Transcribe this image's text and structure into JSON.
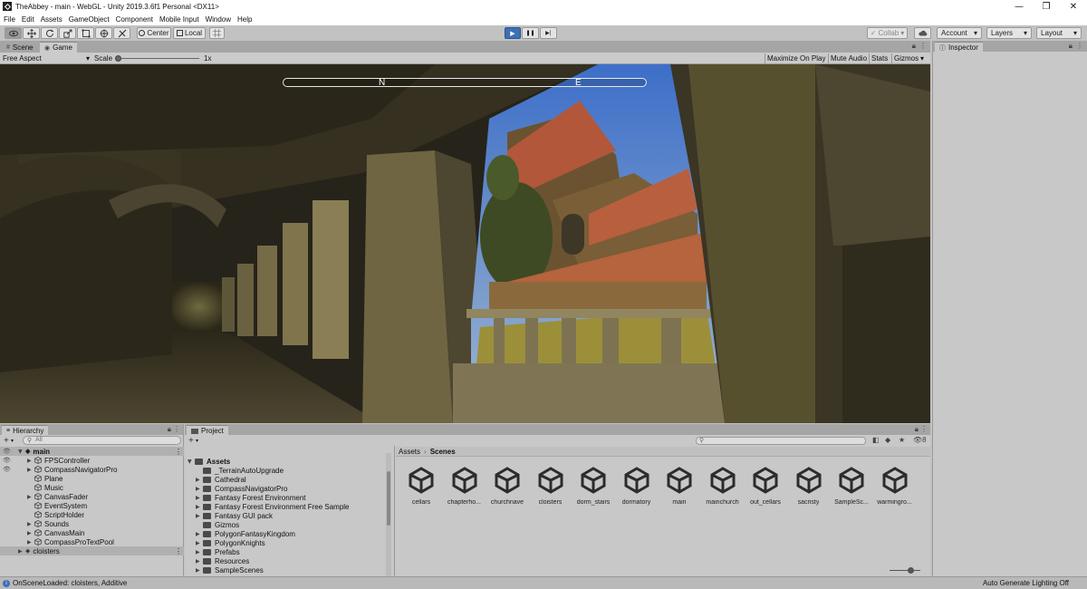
{
  "window": {
    "title": "TheAbbey - main - WebGL - Unity 2019.3.6f1 Personal <DX11>",
    "minimize_glyph": "—",
    "maximize_glyph": "❐",
    "close_glyph": "✕"
  },
  "menu": [
    "File",
    "Edit",
    "Assets",
    "GameObject",
    "Component",
    "Mobile Input",
    "Window",
    "Help"
  ],
  "toolbar": {
    "tools": [
      "view-tool-icon",
      "move-tool-icon",
      "rotate-tool-icon",
      "scale-tool-icon",
      "rect-tool-icon",
      "transform-tool-icon",
      "custom-tool-icon"
    ],
    "pivot_label": "Center",
    "space_label": "Local",
    "collab_label": "Collab",
    "account_label": "Account",
    "layers_label": "Layers",
    "layout_label": "Layout",
    "dropdown_glyph": "▾",
    "play_glyph": "▶",
    "pause_glyph": "❚❚",
    "step_glyph": "▶|"
  },
  "view_tabs": {
    "scene_label": "Scene",
    "game_label": "Game"
  },
  "game_bar": {
    "aspect_label": "Free Aspect",
    "scale_label": "Scale",
    "scale_value": "1x",
    "scale_fraction": 0.0,
    "maximize_label": "Maximize On Play",
    "mute_label": "Mute Audio",
    "stats_label": "Stats",
    "gizmos_label": "Gizmos"
  },
  "compass": {
    "north": "N",
    "east": "E"
  },
  "inspector": {
    "tab_label": "Inspector"
  },
  "hierarchy": {
    "tab_label": "Hierarchy",
    "search_placeholder": "All",
    "add_glyph": "+",
    "scene_main": "main",
    "items": [
      "FPSController",
      "CompassNavigatorPro",
      "Plane",
      "Music",
      "CanvasFader",
      "EventSystem",
      "ScriptHolder",
      "Sounds",
      "CanvasMain",
      "CompassProTextPool"
    ],
    "scene_cloisters": "cloisters"
  },
  "project": {
    "tab_label": "Project",
    "add_glyph": "+",
    "hidden_count": "8",
    "assets_root": "Assets",
    "folders": [
      "_TerrainAutoUpgrade",
      "Cathedral",
      "CompassNavigatorPro",
      "Fantasy Forest Environment",
      "Fantasy Forest Environment Free Sample",
      "Fantasy GUI pack",
      "Gizmos",
      "PolygonFantasyKingdom",
      "PolygonKnights",
      "Prefabs",
      "Resources",
      "SampleScenes"
    ],
    "breadcrumb_root": "Assets",
    "breadcrumb_sep": "›",
    "breadcrumb_current": "Scenes",
    "scenes": [
      "cellars",
      "chapterho...",
      "churchnave",
      "cloisters",
      "dorm_stairs",
      "dormatory",
      "main",
      "mainchurch",
      "out_cellars",
      "sacristy",
      "SampleSc...",
      "warmingro..."
    ]
  },
  "status": {
    "message": "OnSceneLoaded: cloisters, Additive",
    "lighting": "Auto Generate Lighting Off"
  },
  "colors": {
    "accent_play": "#3d6fb6",
    "panel": "#c8c8c8",
    "selection": "#8e8e8e"
  }
}
